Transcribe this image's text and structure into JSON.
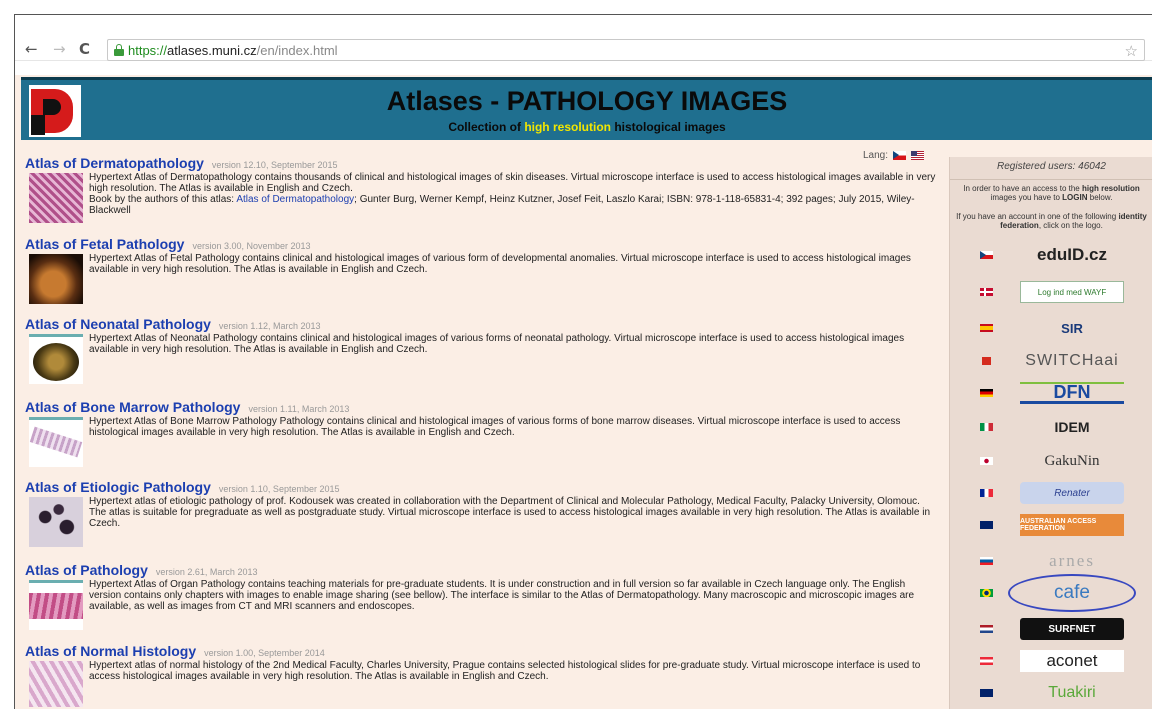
{
  "browser": {
    "back": "←",
    "forward": "→",
    "reload": "C",
    "url_scheme": "https://",
    "url_host": "atlases.muni.cz",
    "url_path": "/en/index.html",
    "bookmark": "☆"
  },
  "banner": {
    "title": "Atlases - PATHOLOGY IMAGES",
    "subtitle_pre": "Collection of ",
    "subtitle_highlight": "high resolution",
    "subtitle_post": " histological images"
  },
  "lang_label": "Lang:",
  "atlases": [
    {
      "title": "Atlas of Dermatopathology",
      "version": "version 12.10, September 2015",
      "desc": "Hypertext Atlas of Dermatopathology contains thousands of clinical and histological images of skin diseases. Virtual microscope interface is used to access histological images available in very high resolution. The Atlas is available in English and Czech.",
      "book_pre": "Book by the authors of this atlas: ",
      "book_link": "Atlas of Dermatopathology",
      "book_post": "; Gunter Burg, Werner Kempf, Heinz Kutzner, Josef Feit, Laszlo Karai; ISBN: 978-1-118-65831-4; 392 pages; July 2015, Wiley-Blackwell"
    },
    {
      "title": "Atlas of Fetal Pathology",
      "version": "version 3.00, November 2013",
      "desc": "Hypertext Atlas of Fetal Pathology contains clinical and histological images of various form of developmental anomalies. Virtual microscope interface is used to access histological images available in very high resolution. The Atlas is available in English and Czech."
    },
    {
      "title": "Atlas of Neonatal Pathology",
      "version": "version 1.12, March 2013",
      "desc": "Hypertext Atlas of Neonatal Pathology contains clinical and histological images of various forms of neonatal pathology. Virtual microscope interface is used to access histological images available in very high resolution. The Atlas is available in English and Czech."
    },
    {
      "title": "Atlas of Bone Marrow Pathology",
      "version": "version 1.11, March 2013",
      "desc": "Hypertext Atlas of Bone Marrow Pathology Pathology contains clinical and histological images of various forms of bone marrow diseases. Virtual microscope interface is used to access histological images available in very high resolution. The Atlas is available in English and Czech."
    },
    {
      "title": "Atlas of Etiologic Pathology",
      "version": "version 1.10, September 2015",
      "desc": "Hypertext atlas of etiologic pathology of prof. Kodousek was created in collaboration with the Department of Clinical and Molecular Pathology, Medical Faculty, Palacky University, Olomouc. The atlas is suitable for pregraduate as well as postgraduate study. Virtual microscope interface is used to access histological images available in very high resolution. The Atlas is available in Czech."
    },
    {
      "title": "Atlas of Pathology",
      "version": "version 2.61, March 2013",
      "desc": "Hypertext Atlas of Organ Pathology contains teaching materials for pre-graduate students. It is under construction and in full version so far available in Czech language only. The English version contains only chapters with images to enable image sharing (see bellow). The interface is similar to the Atlas of Dermatopathology. Many macroscopic and microscopic images are available, as well as images from CT and MRI scanners and endoscopes."
    },
    {
      "title": "Atlas of Normal Histology",
      "version": "version 1.00, September 2014",
      "desc": "Hypertext atlas of normal histology of the 2nd Medical Faculty, Charles University, Prague contains selected histological slides for pre-graduate study. Virtual microscope interface is used to access histological images available in very high resolution. The Atlas is available in English and Czech."
    }
  ],
  "sidebar": {
    "registered": "Registered users: 46042",
    "login_pre": "In order to have an access to the ",
    "login_bold1": "high resolution",
    "login_mid": " images you have to ",
    "login_bold2": "LOGIN",
    "login_post": " below.",
    "fed_pre": "If you have an account in one of the following ",
    "fed_bold": "identity federation",
    "fed_post": ", click on the logo.",
    "federations": [
      {
        "name": "eduID.cz",
        "flag": "cz"
      },
      {
        "name": "Log ind med WAYF",
        "flag": "dk"
      },
      {
        "name": "SIR",
        "flag": "es"
      },
      {
        "name": "SWITCHaai",
        "flag": "ch"
      },
      {
        "name": "DFN",
        "flag": "de"
      },
      {
        "name": "IDEM",
        "flag": "it"
      },
      {
        "name": "GakuNin",
        "flag": "jp"
      },
      {
        "name": "Renater",
        "flag": "fr"
      },
      {
        "name": "AUSTRALIAN ACCESS FEDERATION",
        "flag": "au"
      },
      {
        "name": "arnes",
        "flag": "si"
      },
      {
        "name": "cafe",
        "flag": "br"
      },
      {
        "name": "SURFNET",
        "flag": "nl"
      },
      {
        "name": "aconet",
        "flag": "at"
      },
      {
        "name": "Tuakiri",
        "flag": "nz"
      }
    ]
  },
  "colors": {
    "banner": "#1f6f8f",
    "page_bg": "#fbeee5",
    "sidebar_bg": "#eadbd2",
    "link": "#1c3fb0",
    "highlight": "#f2e600"
  }
}
